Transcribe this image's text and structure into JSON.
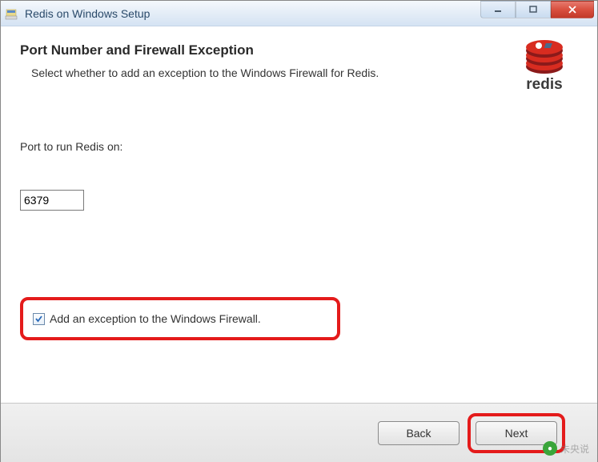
{
  "window": {
    "title": "Redis on Windows Setup"
  },
  "header": {
    "title": "Port Number and Firewall Exception",
    "description": "Select whether to add an exception to the Windows Firewall for Redis.",
    "logo_text": "redis"
  },
  "form": {
    "port_label": "Port to run Redis on:",
    "port_value": "6379",
    "checkbox_label": "Add an exception to the Windows Firewall.",
    "checkbox_checked": true
  },
  "buttons": {
    "back": "Back",
    "next": "Next"
  },
  "watermark": {
    "text": "未央说"
  }
}
